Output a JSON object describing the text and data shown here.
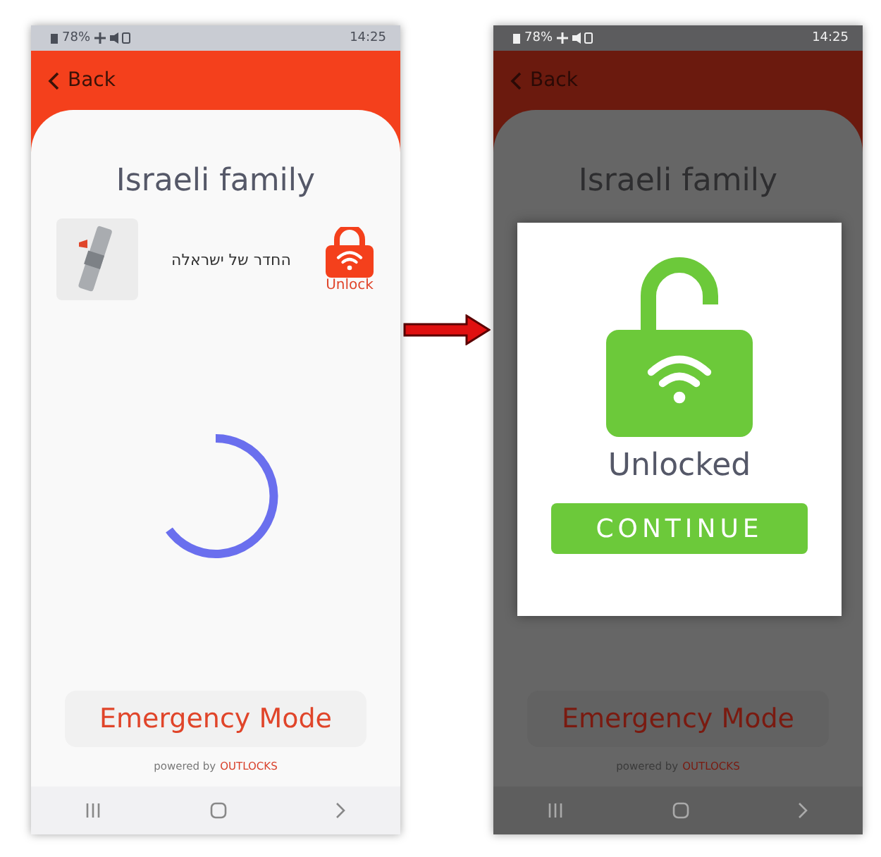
{
  "screens": [
    {
      "status": {
        "battery": "78%",
        "time": "14:25"
      },
      "back": "Back",
      "title": "Israeli family",
      "dimmed": false,
      "lock": {
        "name": "החדר של ישראלה",
        "action": "Unlock"
      },
      "loading": true,
      "emergency": "Emergency Mode",
      "powered_by": "powered by",
      "brand": "OUTLOCKS"
    },
    {
      "status": {
        "battery": "78%",
        "time": "14:25"
      },
      "back": "Back",
      "title": "Israeli family",
      "dimmed": true,
      "dialog": {
        "message": "Unlocked",
        "button": "CONTINUE"
      },
      "emergency": "Emergency Mode",
      "powered_by": "powered by",
      "brand": "OUTLOCKS"
    }
  ]
}
